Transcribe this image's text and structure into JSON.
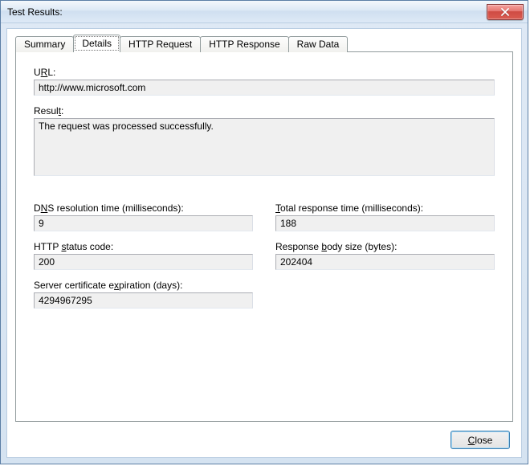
{
  "window": {
    "title": "Test Results:"
  },
  "tabs": {
    "summary": "Summary",
    "details": "Details",
    "http_request": "HTTP Request",
    "http_response": "HTTP Response",
    "raw_data": "Raw Data"
  },
  "labels": {
    "url_pre": "U",
    "url_mn": "R",
    "url_post": "L:",
    "result_pre": "Resul",
    "result_mn": "t",
    "result_post": ":",
    "dns_pre": "D",
    "dns_mn": "N",
    "dns_post": "S resolution time (milliseconds):",
    "total_pre": "",
    "total_mn": "T",
    "total_post": "otal response time (milliseconds):",
    "status_pre": "HTTP ",
    "status_mn": "s",
    "status_post": "tatus code:",
    "body_pre": "Response ",
    "body_mn": "b",
    "body_post": "ody size (bytes):",
    "cert_pre": "Server certificate e",
    "cert_mn": "x",
    "cert_post": "piration (days):"
  },
  "values": {
    "url": "http://www.microsoft.com",
    "result": "The request was processed successfully.",
    "dns": "9",
    "total": "188",
    "status": "200",
    "body_size": "202404",
    "cert_expiration": "4294967295"
  },
  "buttons": {
    "close_pre": "",
    "close_mn": "C",
    "close_post": "lose"
  }
}
